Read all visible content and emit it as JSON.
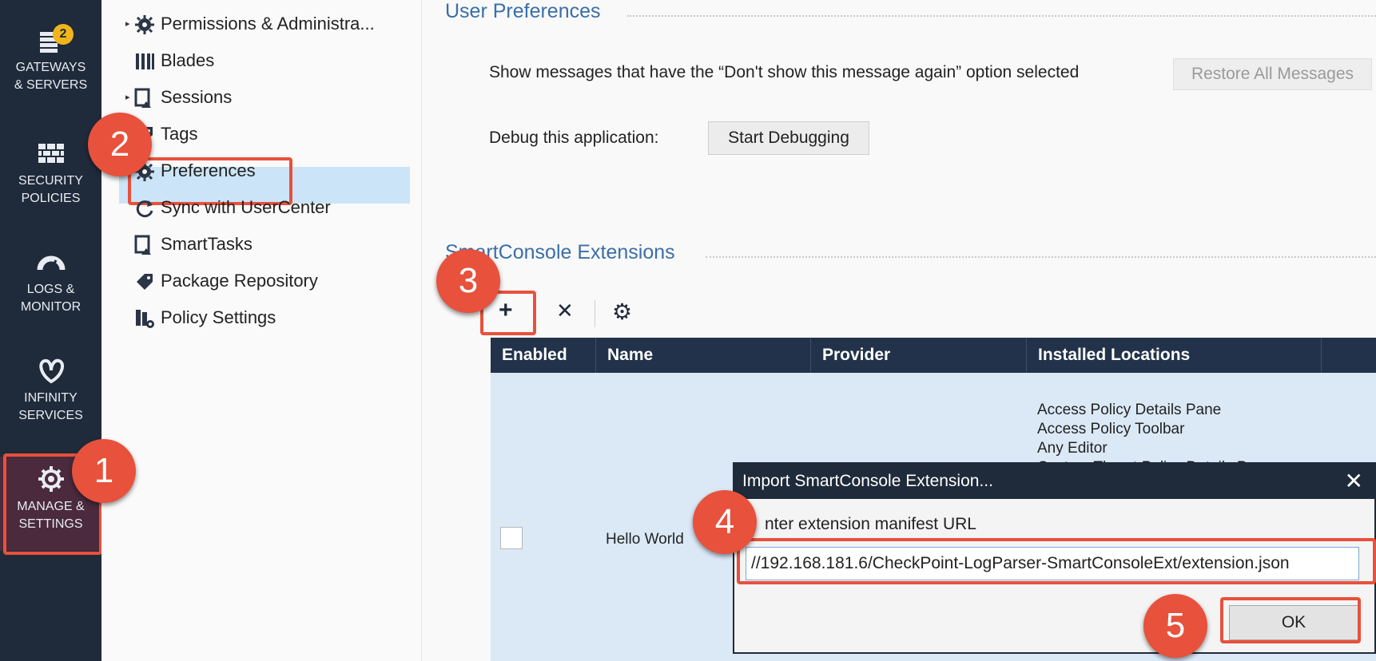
{
  "leftnav": {
    "items": [
      {
        "label_line1": "GATEWAYS",
        "label_line2": "& SERVERS",
        "icon": "servers-icon",
        "badge": "2"
      },
      {
        "label_line1": "SECURITY",
        "label_line2": "POLICIES",
        "icon": "firewall-icon"
      },
      {
        "label_line1": "LOGS &",
        "label_line2": "MONITOR",
        "icon": "gauge-icon"
      },
      {
        "label_line1": "INFINITY",
        "label_line2": "SERVICES",
        "icon": "infinity-icon"
      },
      {
        "label_line1": "MANAGE &",
        "label_line2": "SETTINGS",
        "icon": "gear-icon"
      }
    ]
  },
  "tree": {
    "items": [
      {
        "label": "Permissions & Administra...",
        "icon": "gear-icon",
        "expandable": true
      },
      {
        "label": "Blades",
        "icon": "blades-icon",
        "expandable": false
      },
      {
        "label": "Sessions",
        "icon": "sessions-icon",
        "expandable": true
      },
      {
        "label": "Tags",
        "icon": "tag-icon",
        "expandable": false
      },
      {
        "label": "Preferences",
        "icon": "gear-icon",
        "expandable": false,
        "selected": true
      },
      {
        "label": "Sync with UserCenter",
        "icon": "sync-icon",
        "expandable": false
      },
      {
        "label": "SmartTasks",
        "icon": "smarttasks-icon",
        "expandable": false
      },
      {
        "label": "Package Repository",
        "icon": "tag-icon",
        "expandable": false
      },
      {
        "label": "Policy Settings",
        "icon": "policy-settings-icon",
        "expandable": false
      }
    ]
  },
  "main": {
    "user_prefs_title": "User Preferences",
    "show_messages_label": "Show messages that have the “Don't show this message again” option selected",
    "restore_button": "Restore All Messages",
    "debug_label": "Debug this application:",
    "debug_button": "Start Debugging",
    "extensions_title": "SmartConsole Extensions",
    "toolbar": {
      "add": "+",
      "remove": "✕",
      "settings": "⚙"
    }
  },
  "grid": {
    "columns": [
      "Enabled",
      "Name",
      "Provider",
      "Installed Locations"
    ],
    "row": {
      "name": "Hello World",
      "locations": [
        "Access Policy Details Pane",
        "Access Policy Toolbar",
        "Any Editor",
        "Custom Threat Policy Details Pane"
      ]
    }
  },
  "dialog": {
    "title": "Import SmartConsole Extension...",
    "close": "✕",
    "prompt": "nter extension manifest URL",
    "url_value": "//192.168.181.6/CheckPoint-LogParser-SmartConsoleExt/extension.json",
    "ok_button": "OK"
  },
  "annotations": [
    "1",
    "2",
    "3",
    "4",
    "5"
  ],
  "colors": {
    "accent": "#e8513c",
    "nav_bg": "#1f2a3a",
    "selection": "#cce4f7",
    "badge": "#f0b51c"
  }
}
